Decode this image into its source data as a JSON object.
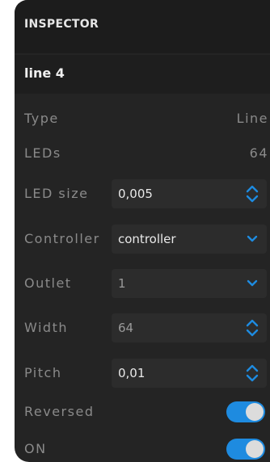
{
  "header": {
    "title": "INSPECTOR"
  },
  "object": {
    "name": "line 4"
  },
  "rows": {
    "type": {
      "label": "Type",
      "value": "Line"
    },
    "leds": {
      "label": "LEDs",
      "value": "64"
    },
    "led_size": {
      "label": "LED size",
      "value": "0,005"
    },
    "controller": {
      "label": "Controller",
      "value": "controller"
    },
    "outlet": {
      "label": "Outlet",
      "value": "1"
    },
    "width": {
      "label": "Width",
      "value": "64"
    },
    "pitch": {
      "label": "Pitch",
      "value": "0,01"
    },
    "reversed": {
      "label": "Reversed",
      "on": true
    },
    "on": {
      "label": "ON",
      "on": true
    }
  },
  "colors": {
    "accent": "#1e8be0",
    "panel": "#242424",
    "label": "#8a8a8a"
  },
  "icons": {
    "stepper": "chevron-up-down-icon",
    "dropdown": "chevron-down-icon"
  }
}
